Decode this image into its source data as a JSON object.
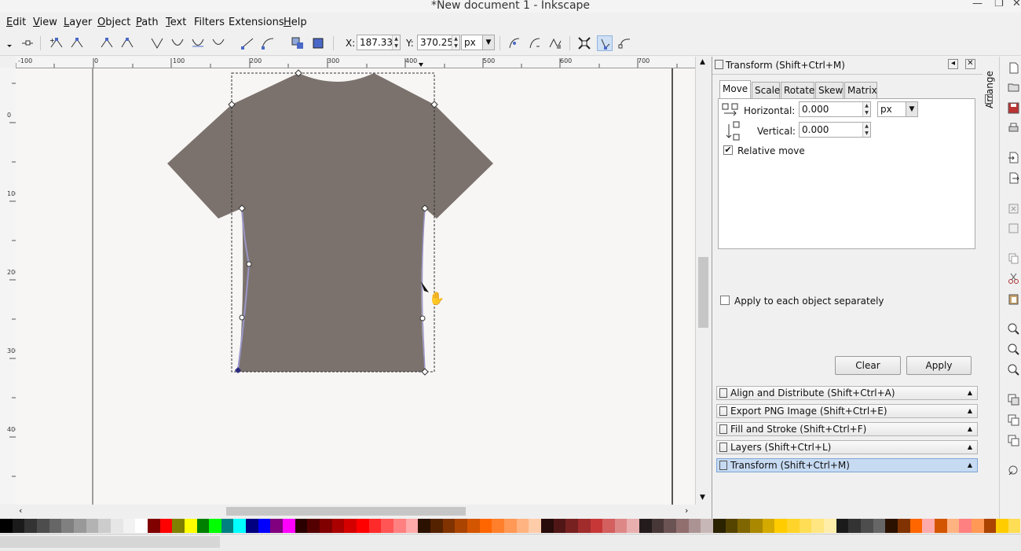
{
  "window": {
    "title": "*New document 1 - Inkscape"
  },
  "menu": {
    "items": [
      {
        "label": "Edit",
        "u": "E",
        "rest": "dit"
      },
      {
        "label": "View",
        "u": "V",
        "rest": "iew"
      },
      {
        "label": "Layer",
        "u": "L",
        "rest": "ayer"
      },
      {
        "label": "Object",
        "u": "O",
        "rest": "bject"
      },
      {
        "label": "Path",
        "u": "P",
        "rest": "ath"
      },
      {
        "label": "Text",
        "u": "T",
        "rest": "ext"
      },
      {
        "label": "Filters",
        "u": "",
        "rest": "Filters"
      },
      {
        "label": "Extensions",
        "u": "",
        "rest": "Extensions"
      },
      {
        "label": "Help",
        "u": "H",
        "rest": "elp"
      }
    ]
  },
  "toolbar": {
    "x_label": "X:",
    "x_value": "187.331",
    "y_label": "Y:",
    "y_value": "370.257",
    "unit": "px"
  },
  "ruler": {
    "h_ticks": [
      "-100",
      "0",
      "100",
      "200",
      "300",
      "400",
      "500",
      "600",
      "700"
    ],
    "v_ticks": [
      "0",
      "100",
      "200",
      "300",
      "400"
    ]
  },
  "transform": {
    "panel_title": "Transform (Shift+Ctrl+M)",
    "tabs": [
      "Move",
      "Scale",
      "Rotate",
      "Skew",
      "Matrix"
    ],
    "active_tab": "Move",
    "horizontal_label": "Horizontal:",
    "horizontal_value": "0.000",
    "vertical_label": "Vertical:",
    "vertical_value": "0.000",
    "unit": "px",
    "relative_move_label": "Relative move",
    "relative_move_checked": true,
    "apply_each_label": "Apply to each object separately",
    "apply_each_checked": false,
    "clear_label": "Clear",
    "apply_label": "Apply"
  },
  "dock": {
    "arrange_label": "Arrange",
    "items": [
      "Align and Distribute (Shift+Ctrl+A)",
      "Export PNG Image (Shift+Ctrl+E)",
      "Fill and Stroke (Shift+Ctrl+F)",
      "Layers (Shift+Ctrl+L)",
      "Transform (Shift+Ctrl+M)"
    ],
    "selected_index": 4
  },
  "colors": {
    "shirt": "#7b726d",
    "selection_handle": "#2a2a80",
    "accent": "#c6daf2"
  },
  "palette": [
    "#000000",
    "#1a1a1a",
    "#333333",
    "#4d4d4d",
    "#666666",
    "#808080",
    "#999999",
    "#b3b3b3",
    "#cccccc",
    "#e6e6e6",
    "#f2f2f2",
    "#ffffff",
    "#800000",
    "#ff0000",
    "#808000",
    "#ffff00",
    "#008000",
    "#00ff00",
    "#008080",
    "#00ffff",
    "#000080",
    "#0000ff",
    "#800080",
    "#ff00ff",
    "#2b0000",
    "#550000",
    "#800000",
    "#aa0000",
    "#d40000",
    "#ff0000",
    "#ff2a2a",
    "#ff5555",
    "#ff8080",
    "#ffaaaa",
    "#2b1100",
    "#552200",
    "#803300",
    "#aa4400",
    "#d45500",
    "#ff6600",
    "#ff7f2a",
    "#ff9955",
    "#ffb380",
    "#ffccaa",
    "#280b0b",
    "#501616",
    "#782121",
    "#a02c2c",
    "#c83737",
    "#d35f5f",
    "#de8787",
    "#e9afaf",
    "#241c1c",
    "#483737",
    "#6c5353",
    "#916f6f",
    "#ac9393",
    "#c8b7b7",
    "#2b2200",
    "#554400",
    "#806600",
    "#aa8800",
    "#d4aa00",
    "#ffcc00",
    "#ffd42a",
    "#ffdd55",
    "#ffe680",
    "#ffeeaa",
    "#1a1a1a",
    "#333333",
    "#4d4d4d",
    "#666666",
    "#2b1100",
    "#803300",
    "#ff6600",
    "#ffaaaa",
    "#d45500",
    "#ffb380",
    "#ff8080",
    "#ff9955",
    "#aa4400",
    "#ffcc00",
    "#ffdd55"
  ]
}
